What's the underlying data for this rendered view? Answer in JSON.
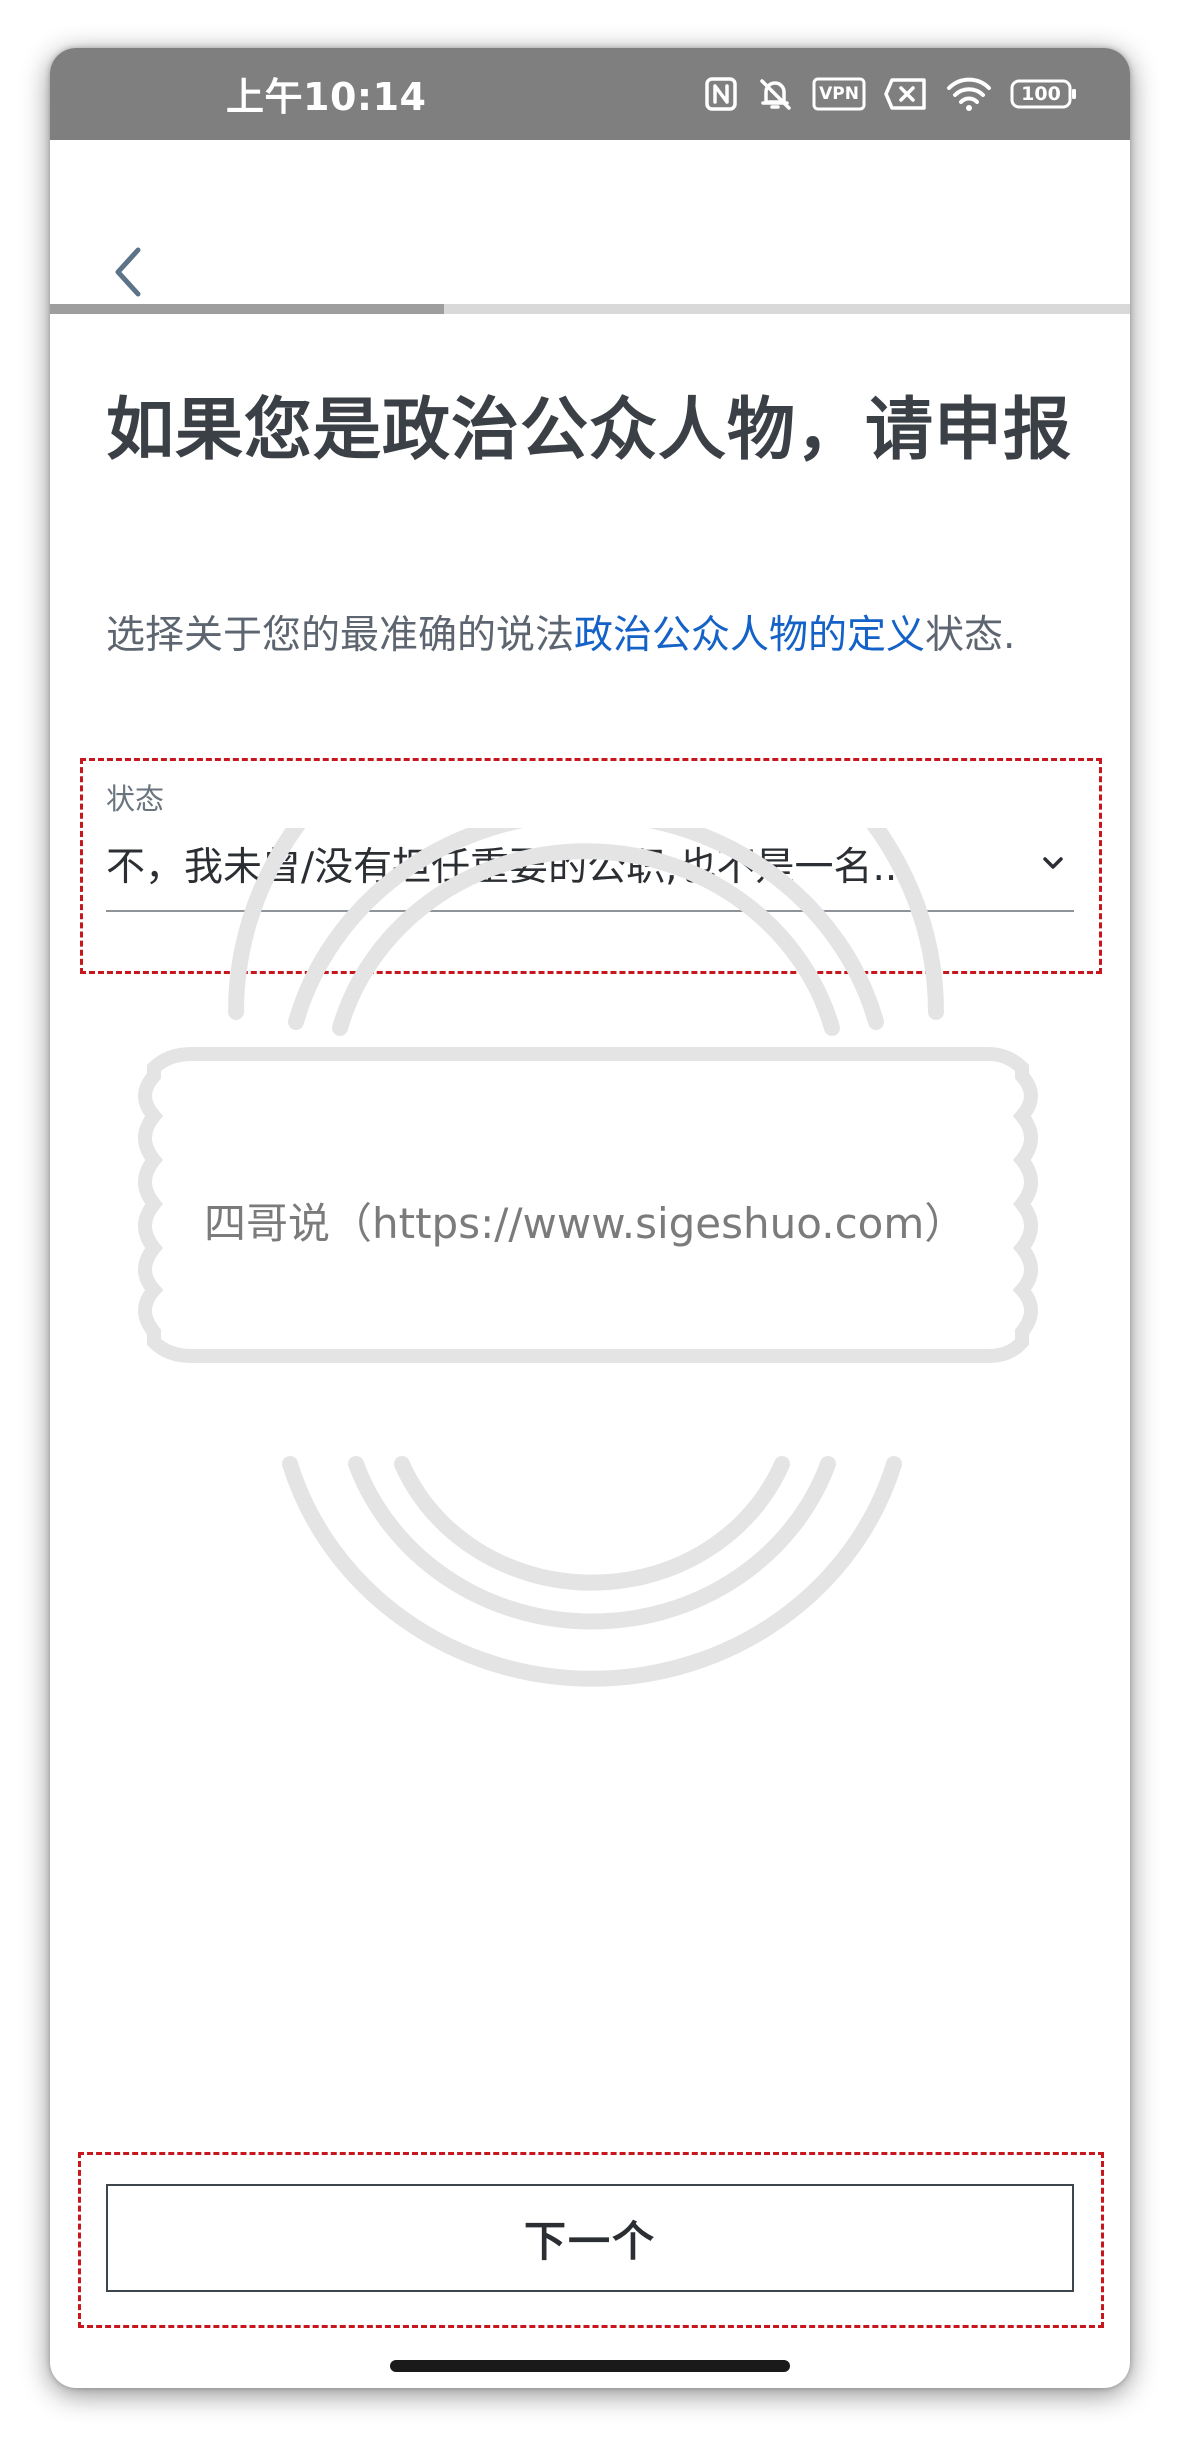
{
  "status_bar": {
    "time": "上午10:14",
    "vpn_label": "VPN",
    "battery_level": "100",
    "icons": [
      "nfc-icon",
      "bell-off-icon",
      "vpn-icon",
      "sim-error-icon",
      "wifi-icon",
      "battery-icon"
    ]
  },
  "header": {
    "back_icon": "chevron-left-icon",
    "progress": 0.365
  },
  "content": {
    "title": "如果您是政治公众人物，请申报",
    "subtitle_prefix": "选择关于您的最准确的说法",
    "subtitle_link": "政治公众人物的定义",
    "subtitle_suffix": "状态.",
    "field": {
      "label": "状态",
      "value": "不，我未曾/没有担任重要的公职,也不是一名...",
      "chevron_icon": "chevron-down-icon"
    }
  },
  "watermark": {
    "text": "四哥说（https://www.sigeshuo.com）"
  },
  "footer": {
    "next_label": "下一个"
  },
  "colors": {
    "status_bar": "#7f7f7f",
    "title": "#3b4046",
    "link": "#1462c8",
    "highlight": "#c8161d",
    "watermark": "#e4e4e4"
  }
}
